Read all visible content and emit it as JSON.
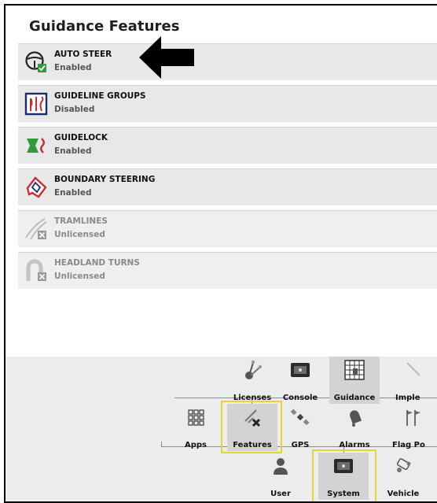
{
  "page": {
    "title": "Guidance Features"
  },
  "features": [
    {
      "name": "AUTO STEER",
      "status": "Enabled",
      "icon": "steering-wheel-icon",
      "licensed": true
    },
    {
      "name": "GUIDELINE GROUPS",
      "status": "Disabled",
      "icon": "guideline-groups-icon",
      "licensed": true
    },
    {
      "name": "GUIDELOCK",
      "status": "Enabled",
      "icon": "guidelock-icon",
      "licensed": true
    },
    {
      "name": "BOUNDARY STEERING",
      "status": "Enabled",
      "icon": "boundary-steering-icon",
      "licensed": true
    },
    {
      "name": "TRAMLINES",
      "status": "Unlicensed",
      "icon": "tramlines-icon",
      "licensed": false
    },
    {
      "name": "HEADLAND TURNS",
      "status": "Unlicensed",
      "icon": "headland-turns-icon",
      "licensed": false
    }
  ],
  "nav": {
    "row1": [
      "Licenses",
      "Console",
      "Guidance",
      "Imple"
    ],
    "row2": [
      "Apps",
      "Features",
      "GPS",
      "Alarms",
      "Flag Po"
    ],
    "row3": [
      "User",
      "System",
      "Vehicle"
    ],
    "selected": [
      "Guidance",
      "Features",
      "System"
    ]
  },
  "colors": {
    "highlight": "#e6d23a",
    "check": "#2e9b3c",
    "guidelock": "#2e9b3c",
    "boundary": "#c0303a"
  }
}
